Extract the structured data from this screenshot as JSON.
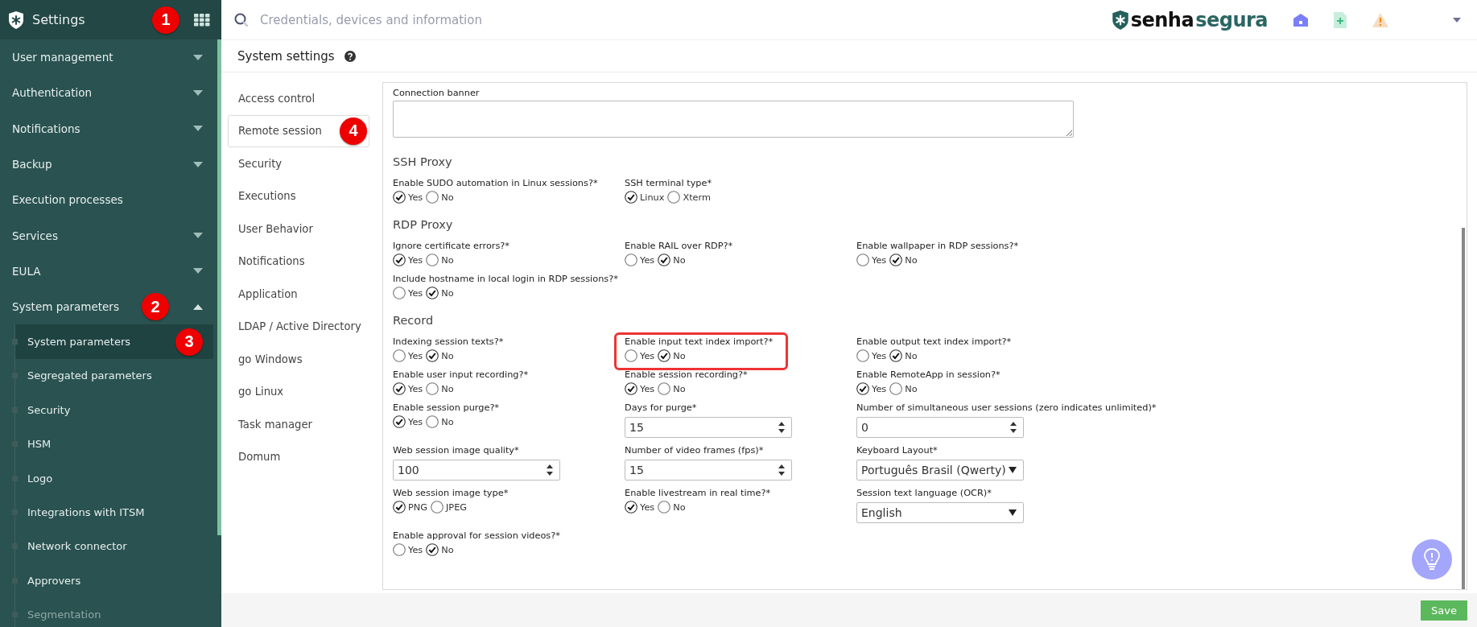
{
  "sidebar": {
    "title": "Settings",
    "title_marker": "1",
    "items": [
      {
        "label": "User management",
        "expanded": false
      },
      {
        "label": "Authentication",
        "expanded": false
      },
      {
        "label": "Notifications",
        "expanded": false
      },
      {
        "label": "Backup",
        "expanded": false
      },
      {
        "label": "Execution processes"
      },
      {
        "label": "Services",
        "expanded": false
      },
      {
        "label": "EULA",
        "expanded": false
      },
      {
        "label": "System parameters",
        "expanded": true,
        "marker": "2",
        "children": [
          {
            "label": "System parameters",
            "selected": true,
            "marker": "3"
          },
          {
            "label": "Segregated parameters",
            "selected": false
          },
          {
            "label": "Security",
            "selected": false
          },
          {
            "label": "HSM",
            "selected": false
          },
          {
            "label": "Logo",
            "selected": false
          },
          {
            "label": "Integrations with ITSM",
            "selected": false
          },
          {
            "label": "Network connector",
            "selected": false
          },
          {
            "label": "Approvers",
            "selected": false
          },
          {
            "label": "Segmentation",
            "selected": false
          }
        ]
      }
    ]
  },
  "topbar": {
    "search": {
      "placeholder": "Credentials, devices and information"
    },
    "logo": {
      "prefix": "senha",
      "suffix": "segura"
    }
  },
  "page": {
    "title": "System settings"
  },
  "tabs": [
    {
      "label": "Access control",
      "selected": false
    },
    {
      "label": "Remote session",
      "selected": true,
      "marker": "4"
    },
    {
      "label": "Security",
      "selected": false
    },
    {
      "label": "Executions",
      "selected": false
    },
    {
      "label": "User Behavior",
      "selected": false
    },
    {
      "label": "Notifications",
      "selected": false
    },
    {
      "label": "Application",
      "selected": false
    },
    {
      "label": "LDAP / Active Directory",
      "selected": false
    },
    {
      "label": "go Windows",
      "selected": false
    },
    {
      "label": "go Linux",
      "selected": false
    },
    {
      "label": "Task manager",
      "selected": false
    },
    {
      "label": "Domum",
      "selected": false
    }
  ],
  "form": {
    "sections": [
      {
        "rows": [
          [
            {
              "kind": "textarea",
              "label": "Connection banner"
            }
          ]
        ]
      },
      {
        "title": "SSH Proxy",
        "rows": [
          [
            {
              "kind": "radio",
              "label": "Enable SUDO automation in Linux sessions?*",
              "options": [
                {
                  "label": "Yes",
                  "selected": true
                },
                {
                  "label": "No",
                  "selected": false
                }
              ]
            },
            {
              "kind": "radio",
              "label": "SSH terminal type*",
              "options": [
                {
                  "label": "Linux",
                  "selected": true
                },
                {
                  "label": "Xterm",
                  "selected": false
                }
              ]
            }
          ]
        ]
      },
      {
        "title": "RDP Proxy",
        "rows": [
          [
            {
              "kind": "radio",
              "label": "Ignore certificate errors?*",
              "options": [
                {
                  "label": "Yes",
                  "selected": true
                },
                {
                  "label": "No",
                  "selected": false
                }
              ]
            },
            {
              "kind": "radio",
              "label": "Enable RAIL over RDP?*",
              "options": [
                {
                  "label": "Yes",
                  "selected": false
                },
                {
                  "label": "No",
                  "selected": true
                }
              ]
            },
            {
              "kind": "radio",
              "label": "Enable wallpaper in RDP sessions?*",
              "options": [
                {
                  "label": "Yes",
                  "selected": false
                },
                {
                  "label": "No",
                  "selected": true
                }
              ]
            }
          ],
          [
            {
              "kind": "radio",
              "label": "Include hostname in local login in RDP sessions?*",
              "options": [
                {
                  "label": "Yes",
                  "selected": false
                },
                {
                  "label": "No",
                  "selected": true
                }
              ]
            }
          ]
        ]
      },
      {
        "title": "Record",
        "rows": [
          [
            {
              "kind": "radio",
              "label": "Indexing session texts?*",
              "options": [
                {
                  "label": "Yes",
                  "selected": false
                },
                {
                  "label": "No",
                  "selected": true
                }
              ]
            },
            {
              "kind": "radio",
              "label": "Enable input text index import?*",
              "highlighted": true,
              "options": [
                {
                  "label": "Yes",
                  "selected": false
                },
                {
                  "label": "No",
                  "selected": true
                }
              ]
            },
            {
              "kind": "radio",
              "label": "Enable output text index import?*",
              "options": [
                {
                  "label": "Yes",
                  "selected": false
                },
                {
                  "label": "No",
                  "selected": true
                }
              ]
            }
          ],
          [
            {
              "kind": "radio",
              "label": "Enable user input recording?*",
              "options": [
                {
                  "label": "Yes",
                  "selected": true
                },
                {
                  "label": "No",
                  "selected": false
                }
              ]
            },
            {
              "kind": "radio",
              "label": "Enable session recording?*",
              "options": [
                {
                  "label": "Yes",
                  "selected": true
                },
                {
                  "label": "No",
                  "selected": false
                }
              ]
            },
            {
              "kind": "radio",
              "label": "Enable RemoteApp in session?*",
              "options": [
                {
                  "label": "Yes",
                  "selected": true
                },
                {
                  "label": "No",
                  "selected": false
                }
              ]
            }
          ],
          [
            {
              "kind": "radio",
              "label": "Enable session purge?*",
              "options": [
                {
                  "label": "Yes",
                  "selected": true
                },
                {
                  "label": "No",
                  "selected": false
                }
              ]
            },
            {
              "kind": "number",
              "label": "Days for purge*",
              "value": "15"
            },
            {
              "kind": "number",
              "label": "Number of simultaneous user sessions (zero indicates unlimited)*",
              "value": "0"
            }
          ],
          [
            {
              "kind": "number",
              "label": "Web session image quality*",
              "value": "100"
            },
            {
              "kind": "number",
              "label": "Number of video frames (fps)*",
              "value": "15"
            },
            {
              "kind": "select",
              "label": "Keyboard Layout*",
              "value": "Português Brasil (Qwerty)"
            }
          ],
          [
            {
              "kind": "radio",
              "label": "Web session image type*",
              "options": [
                {
                  "label": "PNG",
                  "selected": true
                },
                {
                  "label": "JPEG",
                  "selected": false
                }
              ]
            },
            {
              "kind": "radio",
              "label": "Enable livestream in real time?*",
              "options": [
                {
                  "label": "Yes",
                  "selected": true
                },
                {
                  "label": "No",
                  "selected": false
                }
              ]
            },
            {
              "kind": "select",
              "label": "Session text language (OCR)*",
              "value": "English"
            }
          ],
          [
            {
              "kind": "radio",
              "label": "Enable approval for session videos?*",
              "options": [
                {
                  "label": "Yes",
                  "selected": false
                },
                {
                  "label": "No",
                  "selected": true
                }
              ]
            }
          ]
        ]
      }
    ]
  },
  "footer": {
    "save": "Save"
  }
}
